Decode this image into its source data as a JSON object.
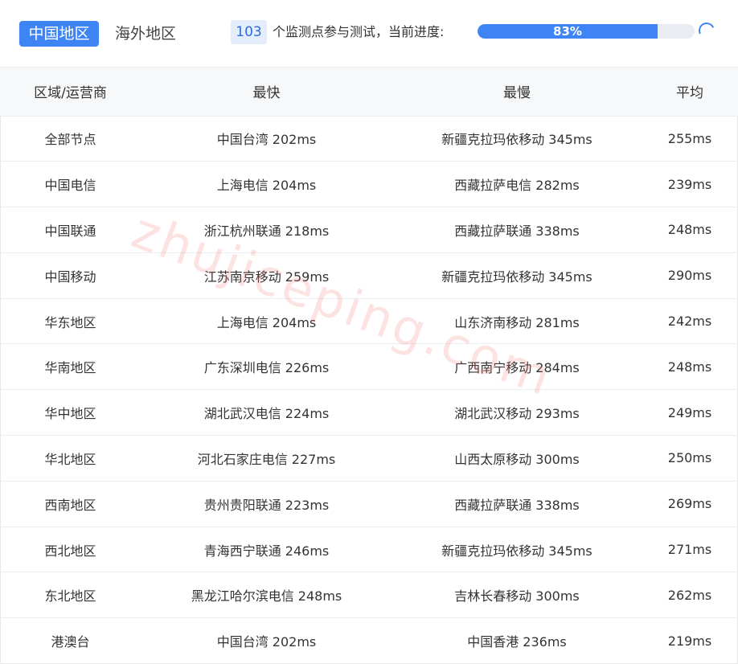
{
  "tabs": {
    "active": "中国地区",
    "inactive": "海外地区"
  },
  "status": {
    "node_count": "103",
    "text": "个监测点参与测试，当前进度:",
    "progress_label": "83%",
    "progress_value": 83
  },
  "table": {
    "headers": [
      "区域/运营商",
      "最快",
      "最慢",
      "平均"
    ],
    "rows": [
      [
        "全部节点",
        "中国台湾 202ms",
        "新疆克拉玛依移动 345ms",
        "255ms"
      ],
      [
        "中国电信",
        "上海电信 204ms",
        "西藏拉萨电信 282ms",
        "239ms"
      ],
      [
        "中国联通",
        "浙江杭州联通 218ms",
        "西藏拉萨联通 338ms",
        "248ms"
      ],
      [
        "中国移动",
        "江苏南京移动 259ms",
        "新疆克拉玛依移动 345ms",
        "290ms"
      ],
      [
        "华东地区",
        "上海电信 204ms",
        "山东济南移动 281ms",
        "242ms"
      ],
      [
        "华南地区",
        "广东深圳电信 226ms",
        "广西南宁移动 284ms",
        "248ms"
      ],
      [
        "华中地区",
        "湖北武汉电信 224ms",
        "湖北武汉移动 293ms",
        "249ms"
      ],
      [
        "华北地区",
        "河北石家庄电信 227ms",
        "山西太原移动 300ms",
        "250ms"
      ],
      [
        "西南地区",
        "贵州贵阳联通 223ms",
        "西藏拉萨联通 338ms",
        "269ms"
      ],
      [
        "西北地区",
        "青海西宁联通 246ms",
        "新疆克拉玛依移动 345ms",
        "271ms"
      ],
      [
        "东北地区",
        "黑龙江哈尔滨电信 248ms",
        "吉林长春移动 300ms",
        "262ms"
      ],
      [
        "港澳台",
        "中国台湾 202ms",
        "中国香港 236ms",
        "219ms"
      ]
    ]
  },
  "watermark": "zhujiceping.com",
  "colors": {
    "accent": "#3e84f4",
    "badge_bg": "#e4edfc",
    "header_bg": "#f7f8fa"
  }
}
